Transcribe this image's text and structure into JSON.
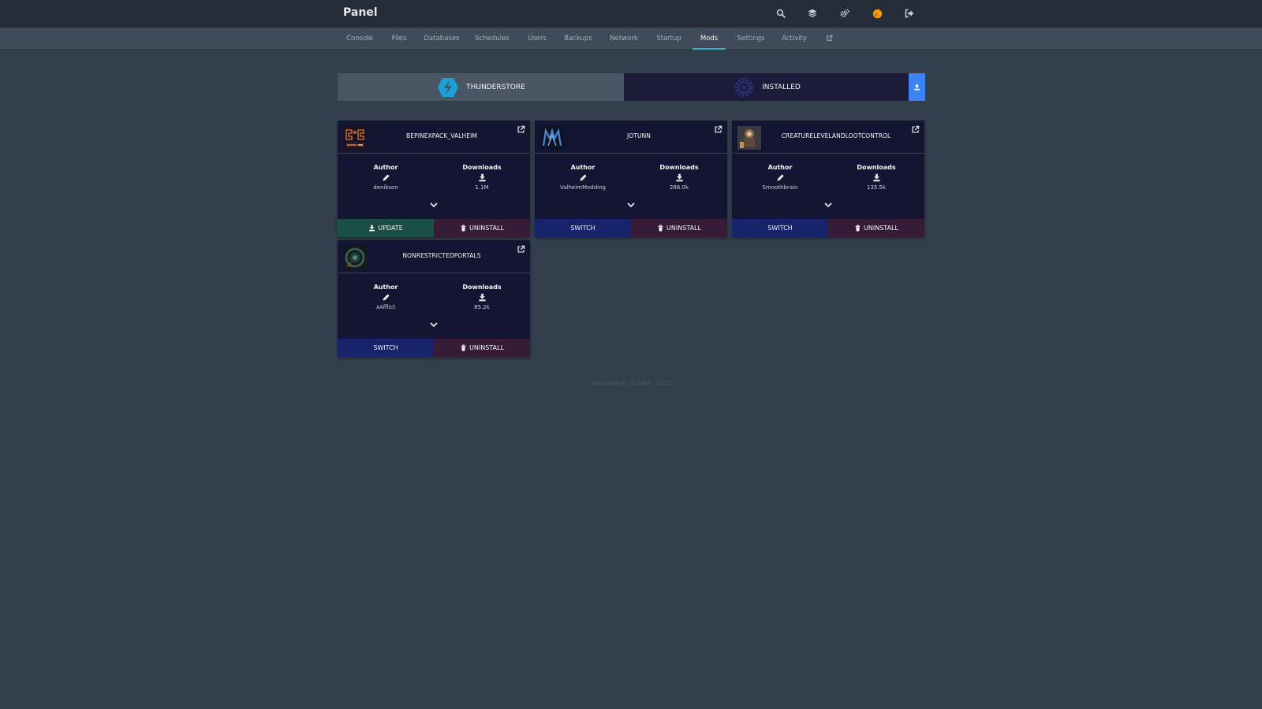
{
  "header": {
    "title": "Panel"
  },
  "nav": {
    "tabs": [
      {
        "label": "Console"
      },
      {
        "label": "Files"
      },
      {
        "label": "Databases"
      },
      {
        "label": "Schedules"
      },
      {
        "label": "Users"
      },
      {
        "label": "Backups"
      },
      {
        "label": "Network"
      },
      {
        "label": "Startup"
      },
      {
        "label": "Mods",
        "active": true
      },
      {
        "label": "Settings"
      },
      {
        "label": "Activity"
      }
    ]
  },
  "mod_tabs": {
    "thunderstore": "THUNDERSTORE",
    "installed": "INSTALLED"
  },
  "mods": [
    {
      "name": "BEPINEXPACK_VALHEIM",
      "author_label": "Author",
      "author": "denikson",
      "downloads_label": "Downloads",
      "downloads": "1.1M",
      "primary": "UPDATE",
      "secondary": "UNINSTALL"
    },
    {
      "name": "JOTUNN",
      "author_label": "Author",
      "author": "ValheimModding",
      "downloads_label": "Downloads",
      "downloads": "286.0k",
      "primary": "SWITCH",
      "secondary": "UNINSTALL"
    },
    {
      "name": "CREATURELEVELANDLOOTCONTROL",
      "author_label": "Author",
      "author": "Smoothbrain",
      "downloads_label": "Downloads",
      "downloads": "135.5k",
      "primary": "SWITCH",
      "secondary": "UNINSTALL"
    },
    {
      "name": "NONRESTRICTEDPORTALS",
      "author_label": "Author",
      "author": "xAfflict",
      "downloads_label": "Downloads",
      "downloads": "85.2k",
      "primary": "SWITCH",
      "secondary": "UNINSTALL"
    }
  ],
  "footer": {
    "text": "Pterodactyl® © 2015 - 2022"
  },
  "colors": {
    "accent": "#37b3c3",
    "update": "#1b4e45",
    "switch": "#17236a",
    "uninstall": "#361c36",
    "upload": "#3b82f6"
  }
}
